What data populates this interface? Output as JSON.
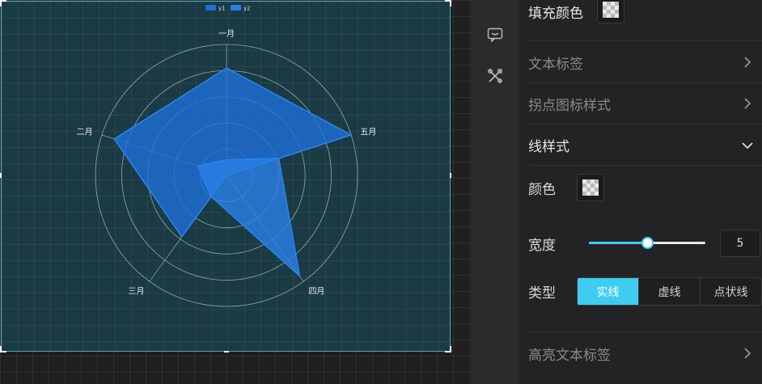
{
  "canvas": {
    "legend": [
      {
        "name": "y1",
        "color": "#1f6fd6"
      },
      {
        "name": "y2",
        "color": "#2a7fe6"
      }
    ],
    "fill_color": "#1f7be0"
  },
  "chart_data": {
    "type": "radar",
    "indicators": [
      "一月",
      "五月",
      "四月",
      "三月",
      "二月"
    ],
    "series": [
      {
        "name": "y1",
        "values": [
          82,
          100,
          0,
          58,
          90
        ]
      },
      {
        "name": "y2",
        "values": [
          12,
          42,
          95,
          20,
          23
        ]
      }
    ],
    "max": 100,
    "grid": "circle",
    "legend_position": "top-center"
  },
  "toolstrip": {
    "icons": [
      "comment-icon",
      "tools-icon"
    ]
  },
  "panel": {
    "fill_color_label": "填充颜色",
    "text_label_section": "文本标签",
    "point_icon_section": "拐点图标样式",
    "line_style_section": "线样式",
    "color_label": "颜色",
    "width_label": "宽度",
    "width_value": "5",
    "width_fraction": 0.5,
    "type_label": "类型",
    "type_options": [
      "实线",
      "虚线",
      "点状线"
    ],
    "type_selected": "实线",
    "highlight_label_section": "高亮文本标签",
    "accent": "#3ecdf0"
  }
}
